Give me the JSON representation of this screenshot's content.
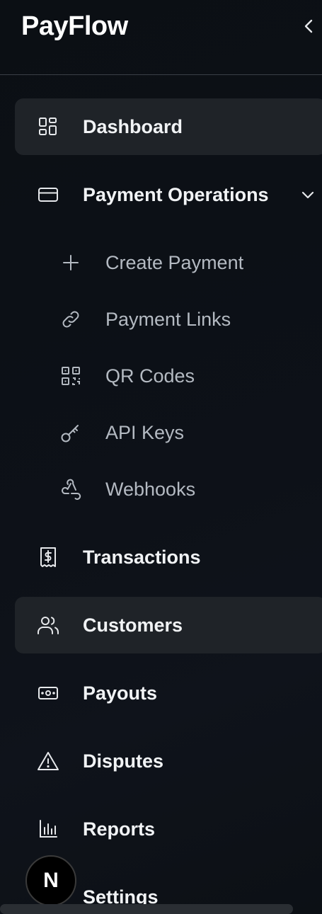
{
  "brand": {
    "name": "PayFlow"
  },
  "sidebar": {
    "collapse_icon": "chevron-left-icon",
    "items": [
      {
        "label": "Dashboard",
        "icon": "dashboard-grid-icon"
      },
      {
        "label": "Payment Operations",
        "icon": "credit-card-icon",
        "chevron": "chevron-down-icon"
      },
      {
        "label": "Transactions",
        "icon": "receipt-dollar-icon"
      },
      {
        "label": "Customers",
        "icon": "users-icon"
      },
      {
        "label": "Payouts",
        "icon": "banknote-icon"
      },
      {
        "label": "Disputes",
        "icon": "alert-triangle-icon"
      },
      {
        "label": "Reports",
        "icon": "bar-chart-icon"
      },
      {
        "label": "Settings",
        "icon": "settings-icon"
      }
    ],
    "sub_items": [
      {
        "label": "Create Payment",
        "icon": "plus-icon"
      },
      {
        "label": "Payment Links",
        "icon": "link-icon"
      },
      {
        "label": "QR Codes",
        "icon": "qr-code-icon"
      },
      {
        "label": "API Keys",
        "icon": "key-icon"
      },
      {
        "label": "Webhooks",
        "icon": "webhook-icon"
      }
    ]
  },
  "avatar": {
    "initial": "N"
  },
  "colors": {
    "background": "#0c1015",
    "active_item": "#1f2328",
    "text_primary": "#f1f3f5",
    "text_secondary": "#b4bac2",
    "divider": "#3a3f46"
  }
}
